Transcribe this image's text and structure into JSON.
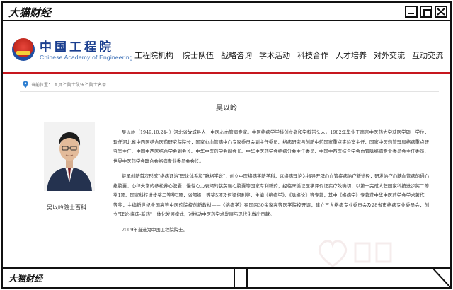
{
  "window": {
    "title": "大猫财经",
    "footer_title": "大猫财经"
  },
  "site": {
    "logo_cn": "中国工程院",
    "logo_en": "Chinese Academy of Engineering",
    "emblem_icon": "cae-emblem-icon"
  },
  "nav": {
    "items": [
      {
        "label": "工程院机构"
      },
      {
        "label": "院士队伍"
      },
      {
        "label": "战略咨询"
      },
      {
        "label": "学术活动"
      },
      {
        "label": "科技合作"
      },
      {
        "label": "人才培养"
      },
      {
        "label": "对外交流"
      },
      {
        "label": "互动交流"
      }
    ]
  },
  "breadcrumb": {
    "prefix": "当前位置：",
    "items": [
      "首页",
      "院士队伍",
      "院士名单"
    ],
    "separator": ">"
  },
  "profile": {
    "name": "吴以岭",
    "caption": "吴以岭院士百科",
    "paragraphs": [
      "吴以岭（1949.10.24- ）河北省故城县人，中医心血管病专家。中医络病学学科创立者和学科带头人。1982年毕业于南京中医药大学获医学硕士学位，现任河北省中西医结合医药研究院院长，国家心血管病中心专家委员会副主任委员、络病研究与创新中药国家重点实验室主任、国家中医药管理局络病重点研究室主任、中国中西医结合学会副会长、中华中医药学会副会长、中华中医药学会络病分会主任委员、中国中西医结合学会血管脉络病专业委员会主任委员、世界中医药学会联合会络病专业委员会会长。",
      "继承创新首次形成\"络病证治\"理论体系和\"脉络学说\"，创立中医络病学新学科，以络病理论为指导开辟心血管疾病治疗新途径，研发治疗心脑血管病的通心络胶囊、心律失常的参松养心胶囊、慢性心力衰竭的芪苈强心胶囊等国家专利新药，经临床循证医学评价证实疗效确切，以第一完成人获国家科技进步奖二等奖1项、国家科技进步奖二等奖3项，省部级一等奖5项及何梁何利奖，主编《络病学》、《脉络论》等专著，其中《络病学》专著获中华中医药学会学术著作一等奖，主编新世纪全国高等中医药院校创新教材——《络病学》在国内30余家高等医学院校开课，建立三大络病专业委员会及28省市络病专业委员会，创立\"理论-临床-新药\"一体化发展模式，对推动中医药学术发展与现代化做出贡献。",
      "2009年当选为中国工程院院士。"
    ]
  },
  "colors": {
    "accent_red": "#c7161e",
    "logo_blue": "#1b3f8f",
    "logo_en_blue": "#3b6fb6",
    "breadcrumb_pin": "#2f7fd1"
  }
}
